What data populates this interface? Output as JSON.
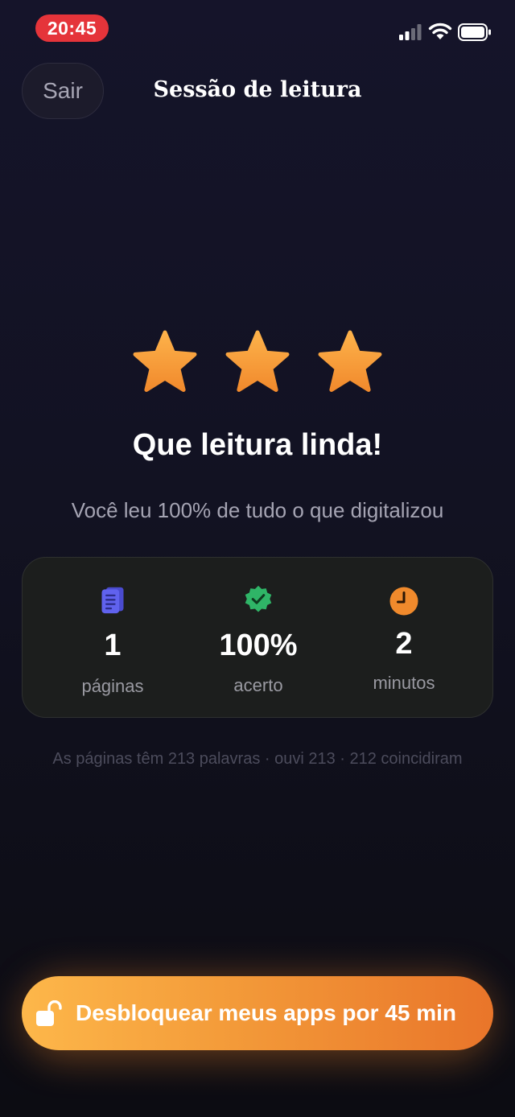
{
  "status_bar": {
    "time": "20:45",
    "icons": [
      "signal-icon",
      "wifi-icon",
      "battery-icon"
    ]
  },
  "header": {
    "exit_label": "Sair",
    "title": "Sessão de leitura"
  },
  "rating": {
    "stars_filled": 3,
    "stars_total": 3,
    "icon": "star-icon",
    "color": "#f59a32"
  },
  "result": {
    "headline": "Que leitura linda!",
    "subline": "Você leu 100% de tudo o que digitalizou"
  },
  "stats": [
    {
      "icon": "document-icon",
      "color": "#5b5ce6",
      "value": "1",
      "label": "páginas"
    },
    {
      "icon": "verified-badge-icon",
      "color": "#2fb567",
      "value": "100%",
      "label": "acerto"
    },
    {
      "icon": "clock-icon",
      "color": "#f08a2c",
      "value": "2",
      "label": "minutos"
    }
  ],
  "footnote": "As páginas têm 213 palavras · ouvi 213 · 212 coincidiram",
  "unlock": {
    "icon": "unlock-icon",
    "label": "Desbloquear meus apps por 45 min"
  },
  "colors": {
    "accent_start": "#fdb74a",
    "accent_end": "#e9752a",
    "background": "#121222",
    "status_pill": "#e5343a"
  }
}
